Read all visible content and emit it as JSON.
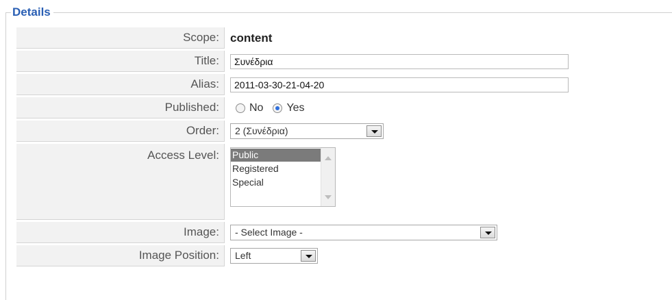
{
  "legend": "Details",
  "rows": {
    "scope": {
      "label": "Scope:",
      "value": "content"
    },
    "title": {
      "label": "Title:",
      "value": "Συνέδρια"
    },
    "alias": {
      "label": "Alias:",
      "value": "2011-03-30-21-04-20"
    },
    "published": {
      "label": "Published:",
      "no": "No",
      "yes": "Yes",
      "selected": "Yes"
    },
    "order": {
      "label": "Order:",
      "value": "2 (Συνέδρια)"
    },
    "access": {
      "label": "Access Level:",
      "options": [
        "Public",
        "Registered",
        "Special"
      ],
      "selected": "Public"
    },
    "image": {
      "label": "Image:",
      "value": "- Select Image -"
    },
    "image_position": {
      "label": "Image Position:",
      "value": "Left"
    }
  }
}
